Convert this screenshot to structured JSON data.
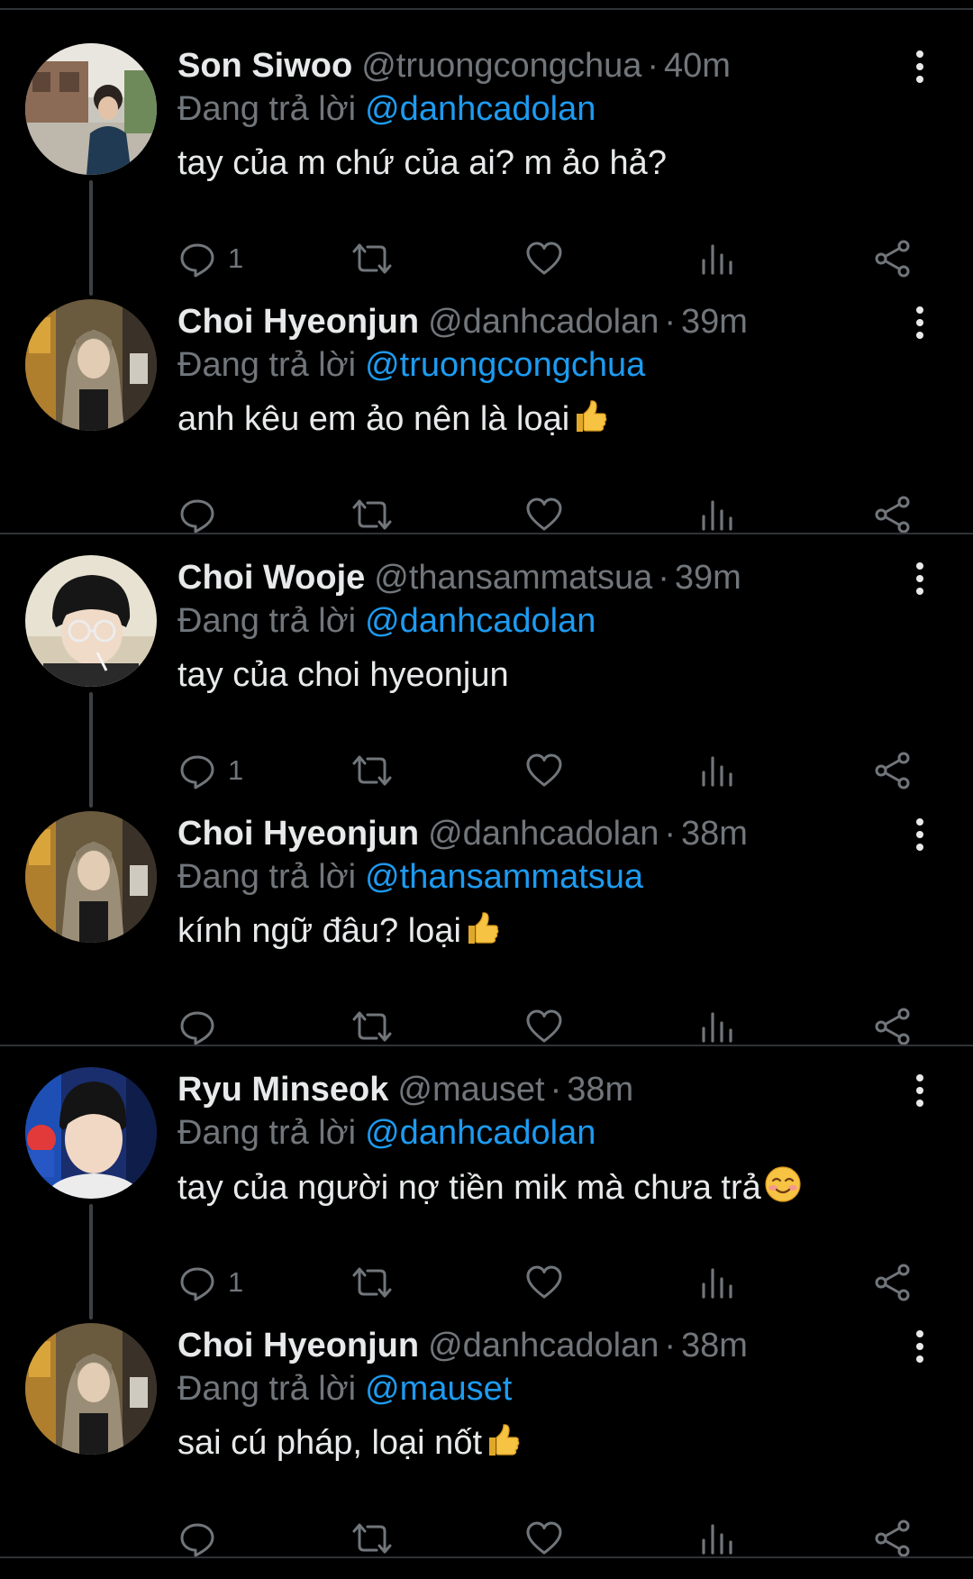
{
  "reply_prefix": "Đang trả lời",
  "colors": {
    "background": "#000000",
    "divider": "#2f3336",
    "muted_text": "#71767b",
    "primary_text": "#e7e9ea",
    "link_blue": "#1d9bf0"
  },
  "icons": {
    "reply": "speech-bubble-icon",
    "retweet": "retweet-icon",
    "like": "heart-icon",
    "views": "bar-chart-icon",
    "share": "share-icon",
    "more": "vertical-ellipsis-icon"
  },
  "tweets": [
    {
      "name": "Son Siwoo",
      "handle": "@truongcongchua",
      "separator": "·",
      "time": "40m",
      "reply_to": "@danhcadolan",
      "text": "tay của m chứ của ai? m ảo hả?",
      "emoji": "",
      "reply_count": "1"
    },
    {
      "name": "Choi Hyeonjun",
      "handle": "@danhcadolan",
      "separator": "·",
      "time": "39m",
      "reply_to": "@truongcongchua",
      "text": "anh kêu em ảo nên là loại",
      "emoji": "thumbs-up",
      "reply_count": ""
    },
    {
      "name": "Choi Wooje",
      "handle": "@thansammatsua",
      "separator": "·",
      "time": "39m",
      "reply_to": "@danhcadolan",
      "text": "tay của choi hyeonjun",
      "emoji": "",
      "reply_count": "1"
    },
    {
      "name": "Choi Hyeonjun",
      "handle": "@danhcadolan",
      "separator": "·",
      "time": "38m",
      "reply_to": "@thansammatsua",
      "text": "kính ngữ đâu? loại",
      "emoji": "thumbs-up",
      "reply_count": ""
    },
    {
      "name": "Ryu Minseok",
      "handle": "@mauset",
      "separator": "·",
      "time": "38m",
      "reply_to": "@danhcadolan",
      "text": "tay của người nợ tiền mik mà chưa trả",
      "emoji": "smiling-face",
      "reply_count": "1"
    },
    {
      "name": "Choi Hyeonjun",
      "handle": "@danhcadolan",
      "separator": "·",
      "time": "38m",
      "reply_to": "@mauset",
      "text": "sai cú pháp, loại nốt",
      "emoji": "thumbs-up",
      "reply_count": ""
    }
  ]
}
